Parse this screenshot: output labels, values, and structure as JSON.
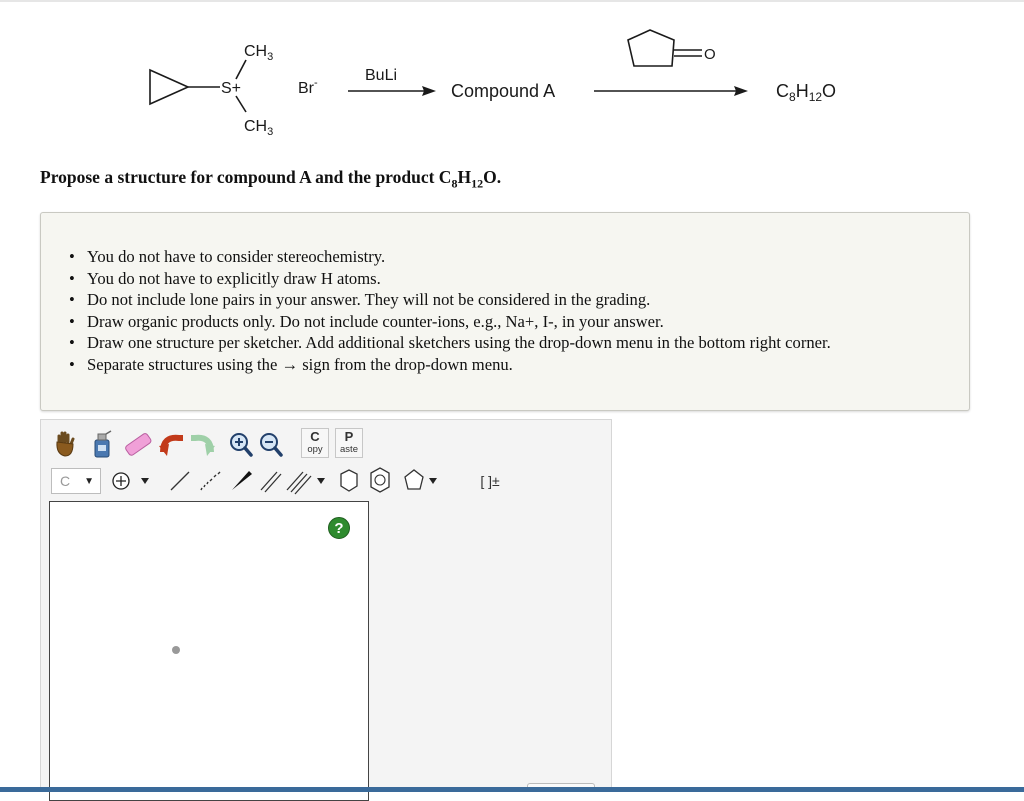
{
  "reaction": {
    "reagent_ch3_top": "CH3",
    "reagent_ch3_bottom": "CH3",
    "sulfonium_atom": "S+",
    "counterion": "Br-",
    "base": "BuLi",
    "intermediate": "Compound A",
    "product_formula": "C8H12O",
    "carbonyl_atom": "O"
  },
  "question": {
    "prefix": "Propose a structure for compound A and the product C",
    "sub1": "8",
    "mid": "H",
    "sub2": "12",
    "suffix": "O."
  },
  "notes": [
    "You do not have to consider stereochemistry.",
    "You do not have to explicitly draw H atoms.",
    "Do not include lone pairs in your answer. They will not be considered in the grading.",
    "Draw organic products only. Do not include counter-ions, e.g., Na+, I-, in your answer.",
    "Draw one structure per sketcher. Add additional sketchers using the drop-down menu in the bottom right corner.",
    "Separate structures using the → sign from the drop-down menu."
  ],
  "sketcher": {
    "atom_selected": "C",
    "copy_big": "C",
    "copy_small": "opy",
    "paste_big": "P",
    "paste_small": "aste",
    "bracket_label": "[ ]±",
    "help_label": "?"
  },
  "icons": [
    "hand-icon",
    "eraser-bottle-icon",
    "eraser-icon",
    "undo-icon",
    "redo-icon",
    "zoom-in-icon",
    "zoom-out-icon",
    "charge-plus-icon",
    "single-bond-icon",
    "hashed-bond-icon",
    "wedge-bond-icon",
    "double-bond-icon",
    "triple-bond-icon",
    "cyclohexane-icon",
    "benzene-icon",
    "cyclopentane-icon"
  ]
}
